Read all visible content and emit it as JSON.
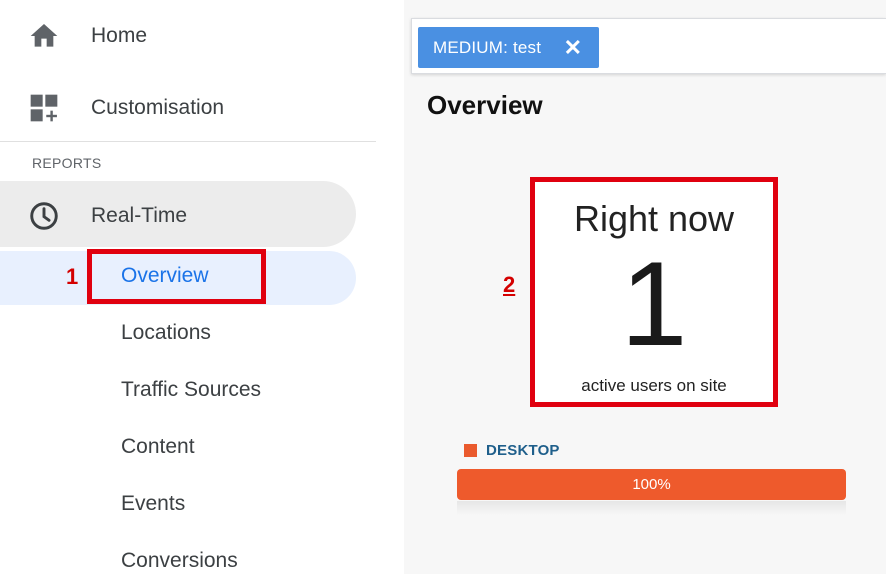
{
  "sidebar": {
    "home_label": "Home",
    "customisation_label": "Customisation",
    "section_label": "REPORTS",
    "realtime_label": "Real-Time",
    "items": [
      {
        "label": "Overview"
      },
      {
        "label": "Locations"
      },
      {
        "label": "Traffic Sources"
      },
      {
        "label": "Content"
      },
      {
        "label": "Events"
      },
      {
        "label": "Conversions"
      }
    ]
  },
  "annotations": {
    "one": "1",
    "two": "2"
  },
  "filter": {
    "chip_label": "MEDIUM: test",
    "close_glyph": "✕"
  },
  "main": {
    "title": "Overview",
    "right_now": {
      "title": "Right now",
      "count": "1",
      "caption": "active users on site"
    },
    "device": {
      "label": "DESKTOP",
      "percent_label": "100%",
      "share": 1.0
    }
  },
  "colors": {
    "accent_blue": "#1a73e8",
    "chip_blue": "#4a90e2",
    "annotation_red": "#e0000f",
    "desktop_orange": "#ee5a2c",
    "legend_text": "#1f5f8b"
  },
  "icons": {
    "home": "home-icon",
    "customisation": "dashboard-add-icon",
    "realtime": "clock-icon",
    "close": "close-icon"
  }
}
